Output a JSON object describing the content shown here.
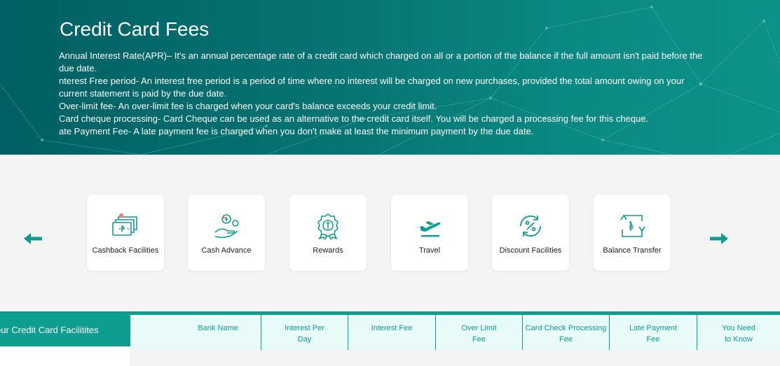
{
  "hero": {
    "title": "Credit Card Fees",
    "descriptions": [
      "Annual Interest Rate(APR)– It's an annual percentage rate of a credit card which charged on all or a portion of the balance if the full amount isn't paid before the due date.",
      "nterest Free period- An interest free period is a period of time where no interest will be charged on new purchases, provided the total amount owing on your current statement is paid by the due date.",
      "Over-limit fee- An over-limit fee is charged when your card's balance exceeds your credit limit.",
      "Card cheque processing- Card Cheque can be used as an alternative to the credit card itself. You will be charged a processing fee for this cheque.",
      "ate Payment Fee- A late payment fee is charged when you don't make at least the minimum payment by the due date."
    ]
  },
  "colors": {
    "accent": "#0e9e8f",
    "hero_dark": "#005f62",
    "header_bg": "#e8fbf9"
  },
  "carousel": {
    "prev_icon": "arrow-left-icon",
    "next_icon": "arrow-right-icon",
    "cards": [
      {
        "label": "Cashback Facilities",
        "icon": "cashback-icon"
      },
      {
        "label": "Cash Advance",
        "icon": "cash-advance-icon"
      },
      {
        "label": "Rewards",
        "icon": "rewards-icon"
      },
      {
        "label": "Travel",
        "icon": "airplane-icon"
      },
      {
        "label": "Discount Facilities",
        "icon": "discount-icon"
      },
      {
        "label": "Balance Transfer",
        "icon": "balance-transfer-icon"
      }
    ]
  },
  "table": {
    "side_tab": "our Credit Card Facilitites",
    "columns": [
      {
        "line1": "Bank Name",
        "line2": ""
      },
      {
        "line1": "Interest Per",
        "line2": "Day"
      },
      {
        "line1": "Interest Fee",
        "line2": ""
      },
      {
        "line1": "Over Limit",
        "line2": "Fee"
      },
      {
        "line1": "Card Check Processing",
        "line2": "Fee"
      },
      {
        "line1": "Late Payment",
        "line2": "Fee"
      },
      {
        "line1": "You Need",
        "line2": "to Know"
      }
    ]
  }
}
